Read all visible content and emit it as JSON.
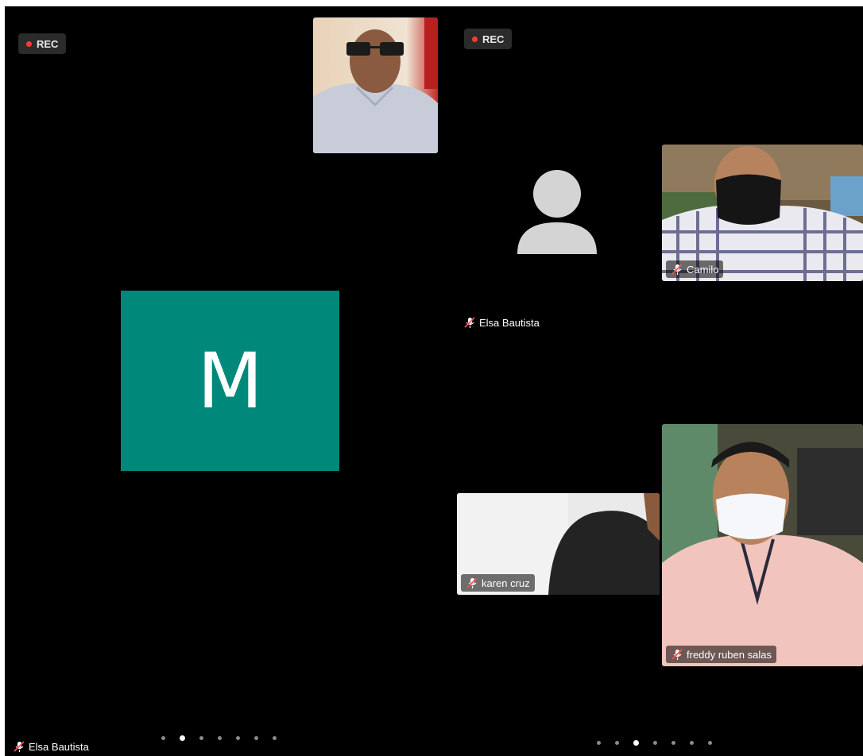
{
  "colors": {
    "background": "#000000",
    "rec_dot": "#ff3b30",
    "avatar_bg": "#00897b",
    "placeholder_gray": "#d4d4d4"
  },
  "left_pane": {
    "rec_label": "REC",
    "avatar_letter": "M",
    "speaker_name": "Elsa Bautista",
    "page_dots_count": 7,
    "page_dots_active_index": 1
  },
  "right_pane": {
    "rec_label": "REC",
    "placeholder_name": "Elsa Bautista",
    "participants": [
      {
        "name": "Camilo"
      },
      {
        "name": "karen cruz"
      },
      {
        "name": "freddy ruben salas"
      }
    ],
    "page_dots_count": 7,
    "page_dots_active_index": 2
  },
  "icons": {
    "mic_off": "mic-off-icon",
    "user_placeholder": "user-placeholder-icon"
  }
}
